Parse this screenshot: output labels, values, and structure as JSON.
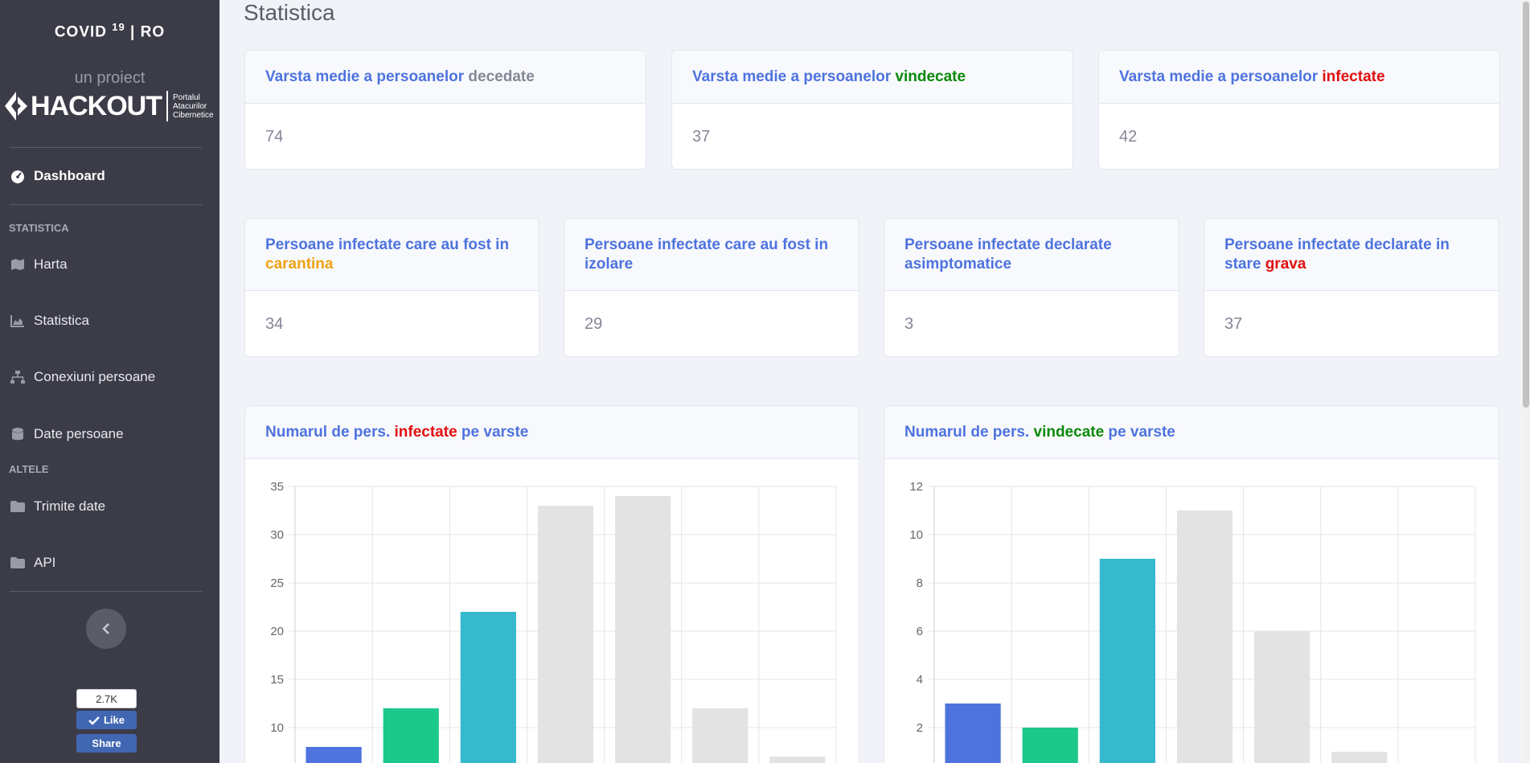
{
  "sidebar": {
    "brand": "COVID",
    "brand_sup": "19",
    "brand_suffix": "| RO",
    "project_label": "un proiect",
    "logo_text": "HACKOUT",
    "logo_sub": [
      "Portalul",
      "Atacurilor",
      "Cibernetice"
    ],
    "dashboard": "Dashboard",
    "section_stat": "STATISTICA",
    "nav_harta": "Harta",
    "nav_statistica": "Statistica",
    "nav_conexiuni": "Conexiuni persoane",
    "nav_date": "Date persoane",
    "section_altele": "ALTELE",
    "nav_trimite": "Trimite date",
    "nav_api": "API",
    "fb_count": "2.7K",
    "fb_like": "Like",
    "fb_share": "Share"
  },
  "main": {
    "title": "Statistica",
    "card1": {
      "prefix": "Varsta medie a persoanelor ",
      "highlight": "decedate",
      "value": "74"
    },
    "card2": {
      "prefix": "Varsta medie a persoanelor ",
      "highlight": "vindecate",
      "value": "37"
    },
    "card3": {
      "prefix": "Varsta medie a persoanelor ",
      "highlight": "infectate",
      "value": "42"
    },
    "card4": {
      "prefix": "Persoane infectate care au fost in ",
      "highlight": "carantina",
      "value": "34"
    },
    "card5": {
      "prefix": "Persoane infectate care au fost in izolare",
      "value": "29"
    },
    "card6": {
      "prefix": "Persoane infectate declarate asimptomatice",
      "value": "3"
    },
    "card7": {
      "prefix": "Persoane infectate declarate in stare ",
      "highlight": "grava",
      "value": "37"
    },
    "chart1_title": {
      "prefix": "Numarul de pers. ",
      "highlight": "infectate",
      "suffix": " pe varste"
    },
    "chart2_title": {
      "prefix": "Numarul de pers. ",
      "highlight": "vindecate",
      "suffix": " pe varste"
    }
  },
  "colors": {
    "accent": "#4e73df",
    "sidebar_bg": "#3b3c48",
    "red": "#e21010",
    "green": "#0a8a0a",
    "orange": "#f0a213"
  },
  "chart_data": [
    {
      "type": "bar",
      "values": [
        8,
        12,
        22,
        33,
        34,
        12,
        7
      ],
      "colors": [
        "#4e73df",
        "#1cc88a",
        "#36b9cc",
        "#e3e3e3",
        "#e3e3e3",
        "#e3e3e3",
        "#e3e3e3"
      ],
      "yticks": [
        "35",
        "30",
        "25",
        "20",
        "15",
        "10"
      ],
      "ylim": [
        5,
        35
      ],
      "grid": true
    },
    {
      "type": "bar",
      "values": [
        3,
        2,
        9,
        11,
        6,
        1,
        0
      ],
      "colors": [
        "#4e73df",
        "#1cc88a",
        "#36b9cc",
        "#e3e3e3",
        "#e3e3e3",
        "#e3e3e3",
        "#e3e3e3"
      ],
      "yticks": [
        "12",
        "10",
        "8",
        "6",
        "4",
        "2"
      ],
      "ylim": [
        0,
        12
      ],
      "grid": true
    }
  ]
}
